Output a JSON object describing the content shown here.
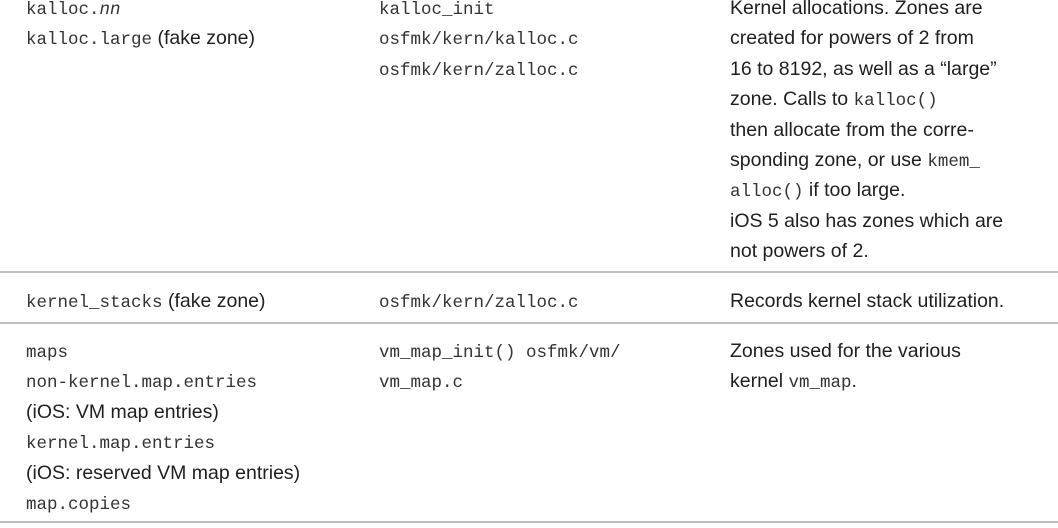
{
  "rows": [
    {
      "zone_lines": [
        [
          {
            "t": "kalloc.",
            "m": true
          },
          {
            "t": "nn",
            "m": true,
            "i": true
          }
        ],
        [
          {
            "t": "kalloc.large",
            "m": true
          },
          {
            "t": " (fake zone)",
            "m": false
          }
        ]
      ],
      "source_lines": [
        [
          {
            "t": "kalloc_init",
            "m": true
          }
        ],
        [
          {
            "t": "osfmk/kern/kalloc.c",
            "m": true
          }
        ],
        [
          {
            "t": "osfmk/kern/zalloc.c",
            "m": true
          }
        ]
      ],
      "desc_lines": [
        [
          {
            "t": "Kernel allocations. Zones are",
            "m": false
          }
        ],
        [
          {
            "t": "created for powers of 2 from",
            "m": false
          }
        ],
        [
          {
            "t": "16 to 8192, as well as a “large”",
            "m": false
          }
        ],
        [
          {
            "t": "zone. Calls to ",
            "m": false
          },
          {
            "t": "kalloc()",
            "m": true
          }
        ],
        [
          {
            "t": "then allocate from the corre-",
            "m": false
          }
        ],
        [
          {
            "t": "sponding zone, or use ",
            "m": false
          },
          {
            "t": "kmem_",
            "m": true
          }
        ],
        [
          {
            "t": "alloc()",
            "m": true
          },
          {
            "t": " if too large.",
            "m": false
          }
        ],
        [
          {
            "t": "iOS 5 also has zones which are",
            "m": false
          }
        ],
        [
          {
            "t": "not powers of 2.",
            "m": false
          }
        ]
      ]
    },
    {
      "zone_lines": [
        [
          {
            "t": "kernel_stacks",
            "m": true
          },
          {
            "t": " (fake zone)",
            "m": false
          }
        ]
      ],
      "source_lines": [
        [
          {
            "t": "osfmk/kern/zalloc.c",
            "m": true
          }
        ]
      ],
      "desc_lines": [
        [
          {
            "t": "Records kernel stack utilization.",
            "m": false
          }
        ]
      ]
    },
    {
      "zone_lines": [
        [
          {
            "t": "maps",
            "m": true
          }
        ],
        [
          {
            "t": "non-kernel.map.entries",
            "m": true
          }
        ],
        [
          {
            "t": "(iOS: VM map entries)",
            "m": false
          }
        ],
        [
          {
            "t": "kernel.map.entries",
            "m": true
          }
        ],
        [
          {
            "t": "(iOS: reserved VM map entries)",
            "m": false
          }
        ],
        [
          {
            "t": "map.copies",
            "m": true
          }
        ]
      ],
      "source_lines": [
        [
          {
            "t": "vm_map_init() osfmk/vm/",
            "m": true
          }
        ],
        [
          {
            "t": "vm_map.c",
            "m": true
          }
        ]
      ],
      "desc_lines": [
        [
          {
            "t": "Zones used for the various",
            "m": false
          }
        ],
        [
          {
            "t": "kernel ",
            "m": false
          },
          {
            "t": "vm_map",
            "m": true
          },
          {
            "t": ".",
            "m": false
          }
        ]
      ]
    }
  ]
}
